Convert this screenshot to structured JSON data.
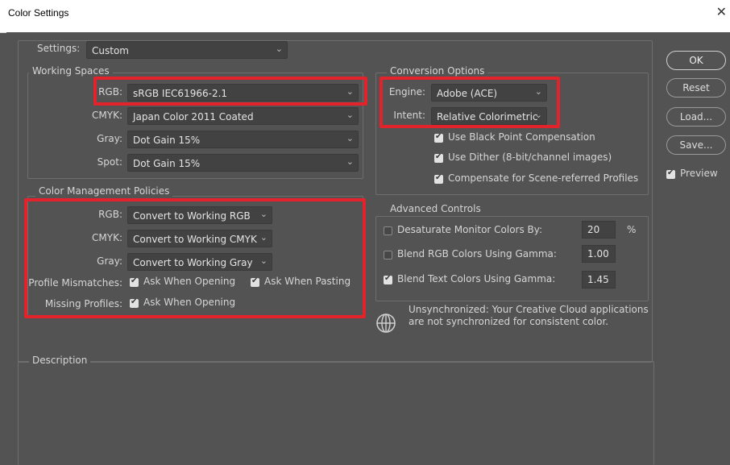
{
  "window": {
    "title": "Color Settings",
    "close_glyph": "✕"
  },
  "settings": {
    "label": "Settings:",
    "value": "Custom"
  },
  "working_spaces": {
    "legend": "Working Spaces",
    "rows": [
      {
        "label": "RGB:",
        "value": "sRGB IEC61966-2.1"
      },
      {
        "label": "CMYK:",
        "value": "Japan Color 2011 Coated"
      },
      {
        "label": "Gray:",
        "value": "Dot Gain 15%"
      },
      {
        "label": "Spot:",
        "value": "Dot Gain 15%"
      }
    ]
  },
  "policies": {
    "legend": "Color Management Policies",
    "rows": [
      {
        "label": "RGB:",
        "value": "Convert to Working RGB"
      },
      {
        "label": "CMYK:",
        "value": "Convert to Working CMYK"
      },
      {
        "label": "Gray:",
        "value": "Convert to Working Gray"
      }
    ],
    "mismatch_label": "Profile Mismatches:",
    "ask_opening": "Ask When Opening",
    "ask_pasting": "Ask When Pasting",
    "missing_label": "Missing Profiles:",
    "missing_ask_opening": "Ask When Opening"
  },
  "conversion": {
    "legend": "Conversion Options",
    "engine_label": "Engine:",
    "engine_value": "Adobe (ACE)",
    "intent_label": "Intent:",
    "intent_value": "Relative Colorimetric",
    "black_point": "Use Black Point Compensation",
    "dither": "Use Dither (8-bit/channel images)",
    "scene_referred": "Compensate for Scene-referred Profiles"
  },
  "advanced": {
    "legend": "Advanced Controls",
    "desaturate_label": "Desaturate Monitor Colors By:",
    "desaturate_value": "20",
    "desaturate_unit": "%",
    "blend_rgb_label": "Blend RGB Colors Using Gamma:",
    "blend_rgb_value": "1.00",
    "blend_text_label": "Blend Text Colors Using Gamma:",
    "blend_text_value": "1.45"
  },
  "sync": {
    "line1": "Unsynchronized: Your Creative Cloud applications",
    "line2": "are not synchronized for consistent color."
  },
  "description": {
    "legend": "Description"
  },
  "buttons": {
    "ok": "OK",
    "reset": "Reset",
    "load": "Load...",
    "save": "Save...",
    "preview": "Preview"
  },
  "colors": {
    "highlight": "#e3232c",
    "dialog_bg": "#535353",
    "field_bg": "#424242"
  }
}
